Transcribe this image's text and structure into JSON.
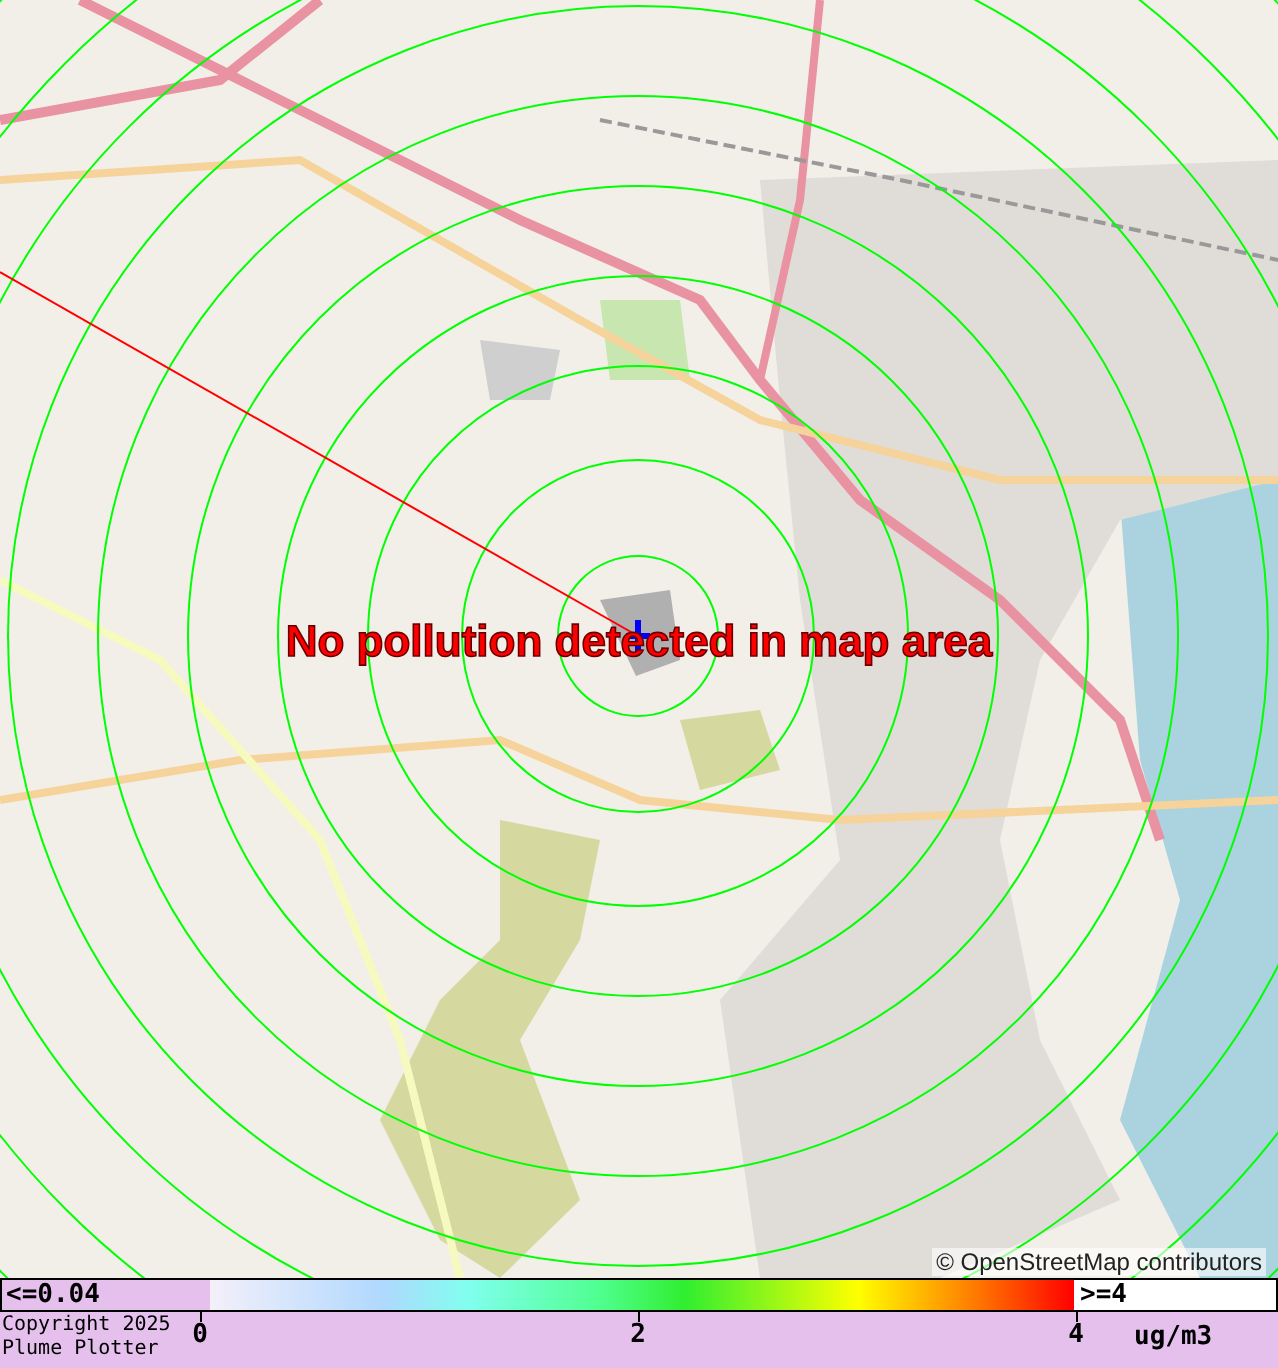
{
  "map": {
    "message": "No pollution detected in map area",
    "attribution": "© OpenStreetMap contributors"
  },
  "legend": {
    "min_label": "<=0.04",
    "max_label": ">=4",
    "ticks": [
      "0",
      "2",
      "4"
    ],
    "unit": "ug/m3"
  },
  "copyright": [
    "Copyright 2025",
    "Plume Plotter"
  ]
}
